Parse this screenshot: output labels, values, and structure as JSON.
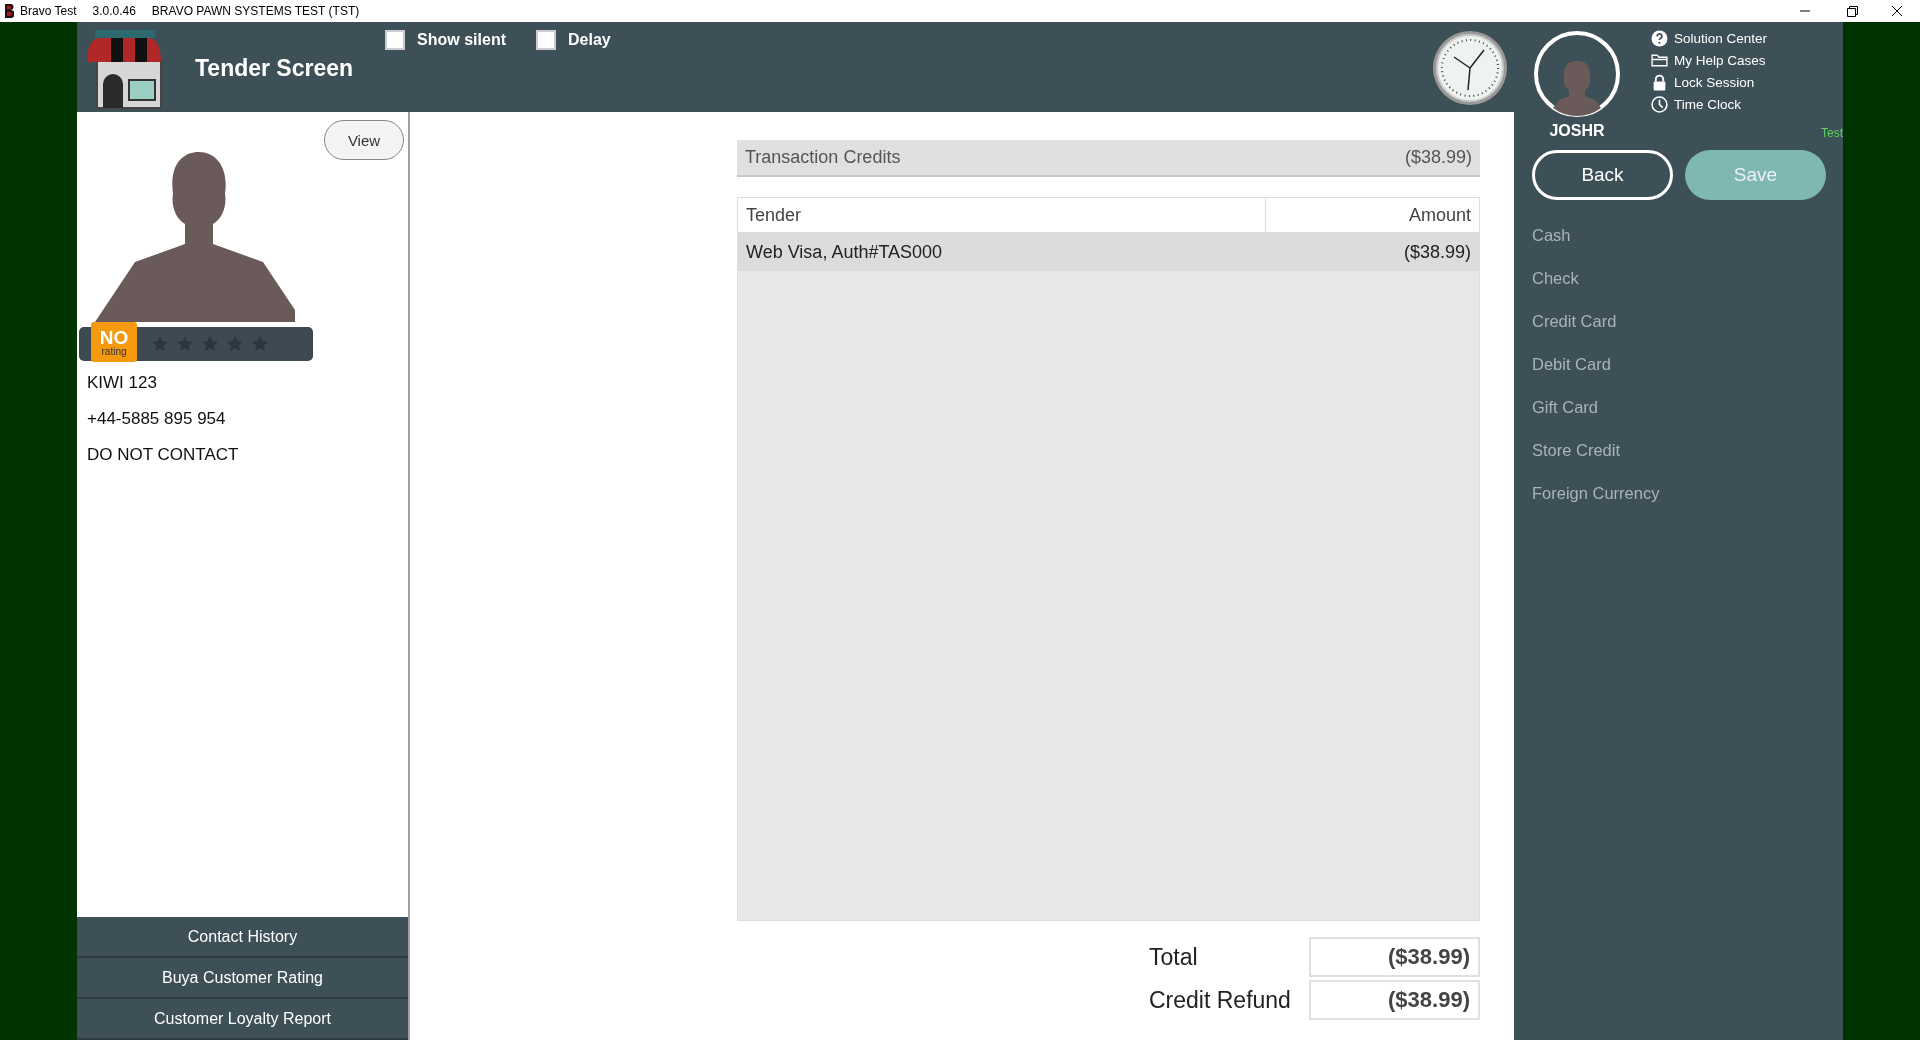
{
  "window": {
    "title": "Bravo Test",
    "version": "3.0.0.46",
    "subtitle": "BRAVO PAWN SYSTEMS TEST (TST)"
  },
  "header": {
    "title": "Tender Screen",
    "options": [
      {
        "label": "Show silent",
        "checked": false
      },
      {
        "label": "Delay",
        "checked": false
      }
    ],
    "user": "JOSHR",
    "links": [
      {
        "kind": "help",
        "label": "Solution Center"
      },
      {
        "kind": "folder",
        "label": "My Help Cases"
      },
      {
        "kind": "lock",
        "label": "Lock Session"
      },
      {
        "kind": "clock",
        "label": "Time Clock"
      }
    ],
    "env_tag": "Test"
  },
  "customer": {
    "view_button": "View",
    "rating_badge": {
      "top": "NO",
      "bottom": "rating"
    },
    "stars": 0,
    "details": [
      "KIWI 123",
      "+44-5885 895 954",
      "DO NOT CONTACT"
    ],
    "actions": [
      "Contact History",
      "Buya Customer Rating",
      "Customer Loyalty Report"
    ]
  },
  "credits": {
    "label": "Transaction Credits",
    "amount": "($38.99)"
  },
  "table": {
    "columns": [
      "Tender",
      "Amount"
    ],
    "rows": [
      {
        "tender": "Web Visa, Auth#TAS000",
        "amount": "($38.99)"
      }
    ]
  },
  "totals": [
    {
      "label": "Total",
      "value": "($38.99)"
    },
    {
      "label": "Credit Refund",
      "value": "($38.99)"
    }
  ],
  "buttons": [
    {
      "kind": "outline",
      "label": "Back"
    },
    {
      "kind": "filled",
      "label": "Save"
    }
  ],
  "tender_types": [
    "Cash",
    "Check",
    "Credit Card",
    "Debit Card",
    "Gift Card",
    "Store Credit",
    "Foreign Currency"
  ]
}
